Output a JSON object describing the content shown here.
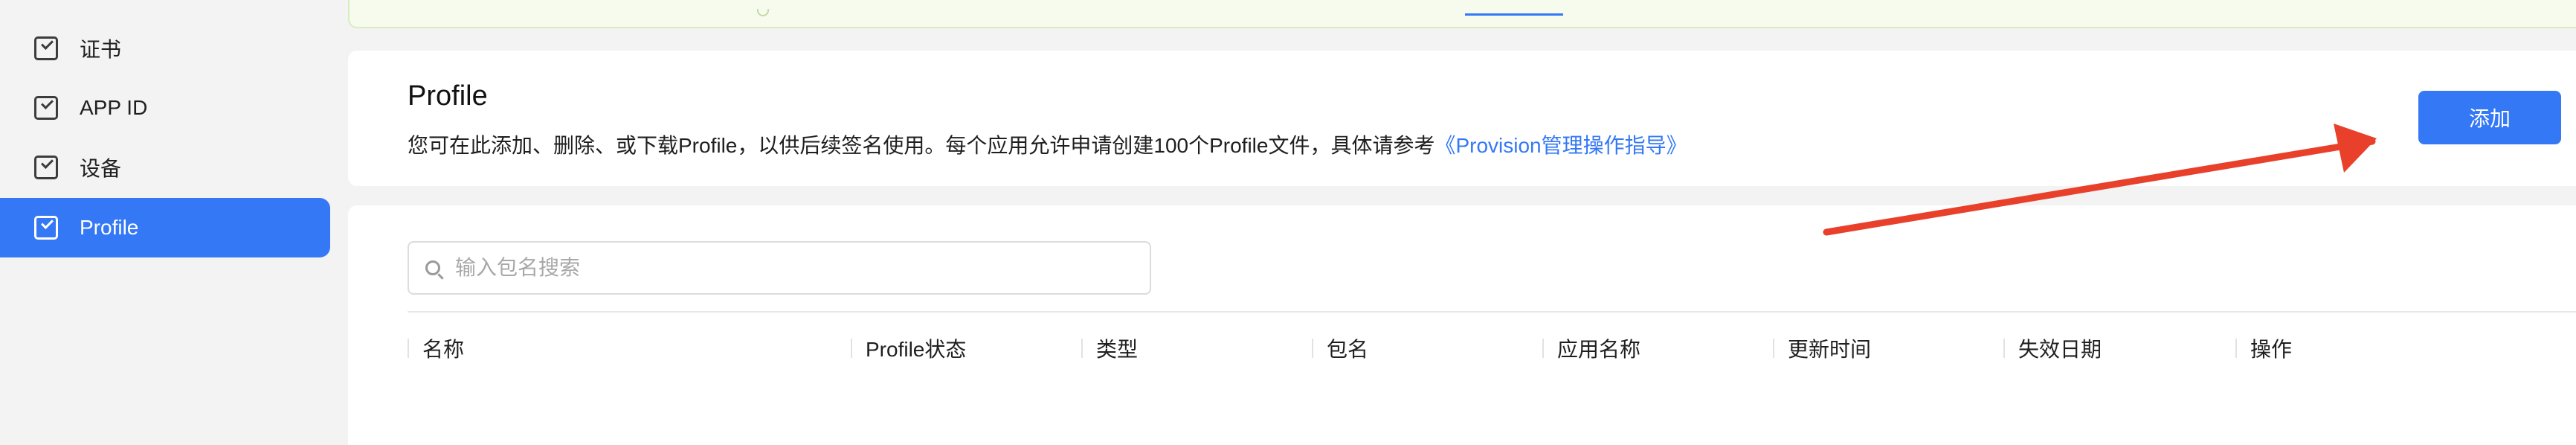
{
  "sidebar": {
    "items": [
      {
        "label": "证书",
        "icon": "certificate-icon"
      },
      {
        "label": "APP ID",
        "icon": "app-id-icon"
      },
      {
        "label": "设备",
        "icon": "device-icon"
      },
      {
        "label": "Profile",
        "icon": "profile-icon",
        "active": true
      }
    ]
  },
  "header": {
    "title": "Profile",
    "description": "您可在此添加、删除、或下载Profile，以供后续签名使用。每个应用允许申请创建100个Profile文件，具体请参考",
    "description_link": "《Provision管理操作指导》",
    "add_label": "添加"
  },
  "search": {
    "placeholder": "输入包名搜索",
    "value": ""
  },
  "table": {
    "columns": [
      "名称",
      "Profile状态",
      "类型",
      "包名",
      "应用名称",
      "更新时间",
      "失效日期",
      "操作"
    ]
  },
  "colors": {
    "accent": "#3478f6",
    "annotation_arrow": "#e8402a",
    "notice_bg": "#f6fbee"
  }
}
